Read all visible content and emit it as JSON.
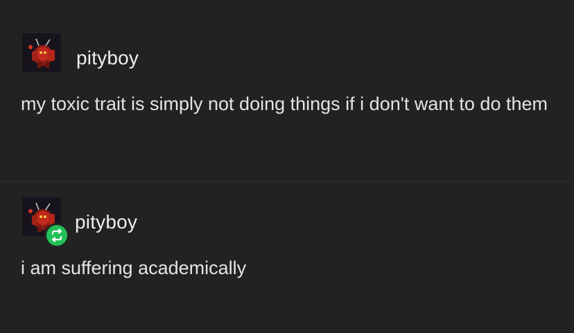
{
  "posts": [
    {
      "username": "pityboy",
      "avatar_icon": "red-robot-avatar-icon",
      "text": "my toxic trait is simply not doing things if i don't want to do them",
      "reblog": false
    },
    {
      "username": "pityboy",
      "avatar_icon": "red-robot-avatar-icon",
      "badge_icon": "reblog-icon",
      "badge_color": "#21c056",
      "text": "i am suffering academically",
      "reblog": true
    }
  ],
  "colors": {
    "background": "#222222",
    "text": "#e4e4e4"
  }
}
